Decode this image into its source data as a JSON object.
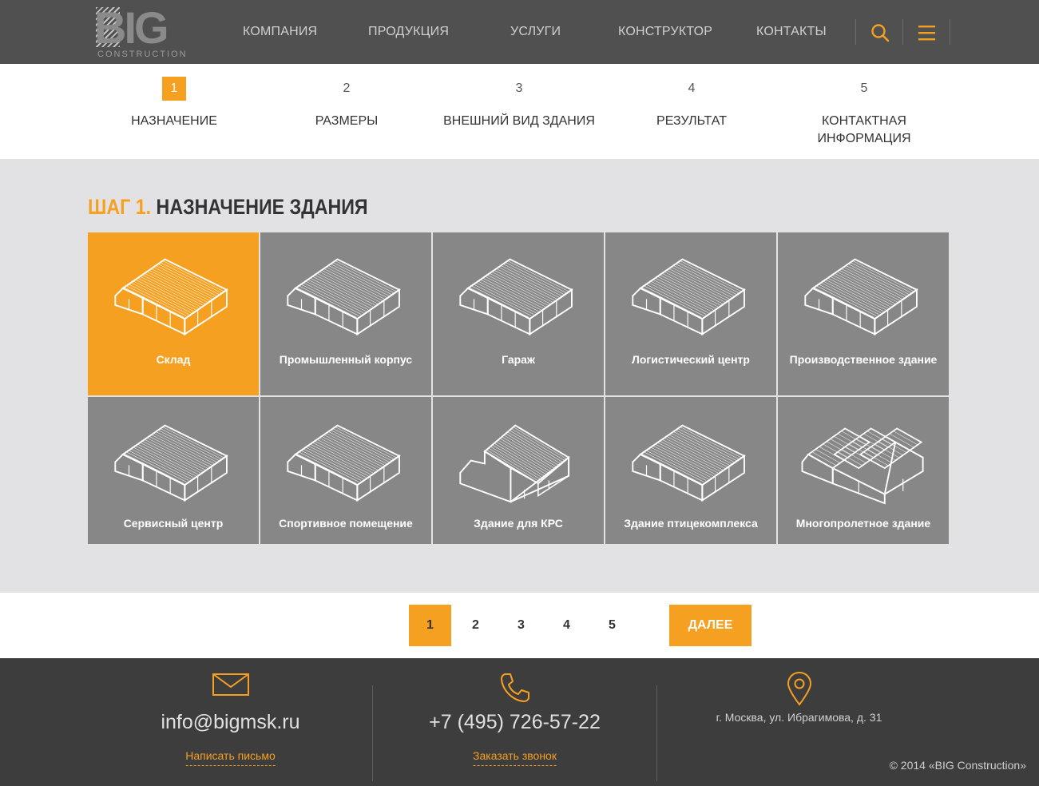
{
  "header": {
    "logo_text": "BIG",
    "logo_subtext": "CONSTRUCTION",
    "nav": [
      "КОМПАНИЯ",
      "ПРОДУКЦИЯ",
      "УСЛУГИ",
      "КОНСТРУКТОР",
      "КОНТАКТЫ"
    ],
    "search_icon": "search-icon",
    "menu_icon": "hamburger-menu-icon"
  },
  "steps": [
    {
      "num": "1",
      "label": "НАЗНАЧЕНИЕ",
      "active": true
    },
    {
      "num": "2",
      "label": "РАЗМЕРЫ",
      "active": false
    },
    {
      "num": "3",
      "label": "ВНЕШНИЙ ВИД ЗДАНИЯ",
      "active": false
    },
    {
      "num": "4",
      "label": "РЕЗУЛЬТАТ",
      "active": false
    },
    {
      "num": "5",
      "label": "КОНТАКТНАЯ ИНФОРМАЦИЯ",
      "active": false
    }
  ],
  "main": {
    "title_accent": "ШАГ 1.",
    "title_rest": "НАЗНАЧЕНИЕ ЗДАНИЯ"
  },
  "building_types": [
    {
      "label": "Склад",
      "selected": true,
      "icon": "gable-building-icon"
    },
    {
      "label": "Промышленный корпус",
      "selected": false,
      "icon": "gable-building-icon"
    },
    {
      "label": "Гараж",
      "selected": false,
      "icon": "gable-building-icon"
    },
    {
      "label": "Логистический центр",
      "selected": false,
      "icon": "gable-building-icon"
    },
    {
      "label": "Производственное здание",
      "selected": false,
      "icon": "gable-building-icon"
    },
    {
      "label": "Сервисный центр",
      "selected": false,
      "icon": "gable-building-icon"
    },
    {
      "label": "Спортивное помещение",
      "selected": false,
      "icon": "gable-building-icon"
    },
    {
      "label": "Здание для КРС",
      "selected": false,
      "icon": "barn-building-icon"
    },
    {
      "label": "Здание птицекомплекса",
      "selected": false,
      "icon": "gable-building-icon"
    },
    {
      "label": "Многопролетное здание",
      "selected": false,
      "icon": "multispan-building-icon"
    }
  ],
  "pagination": {
    "pages": [
      "1",
      "2",
      "3",
      "4",
      "5"
    ],
    "current": "1",
    "next_label": "ДАЛЕЕ"
  },
  "footer": {
    "email": "info@bigmsk.ru",
    "email_link": "Написать письмо",
    "phone": "+7 (495) 726-57-22",
    "phone_link": "Заказать звонок",
    "address": "г. Москва, ул. Ибрагимова, д. 31",
    "copyright": "© 2014 «BIG Construction»",
    "accent_color": "#f5a020"
  },
  "colors": {
    "accent": "#f5a020",
    "header_bg": "#505050",
    "tile_bg": "#878787",
    "footer_bg": "#3d3d3d"
  }
}
